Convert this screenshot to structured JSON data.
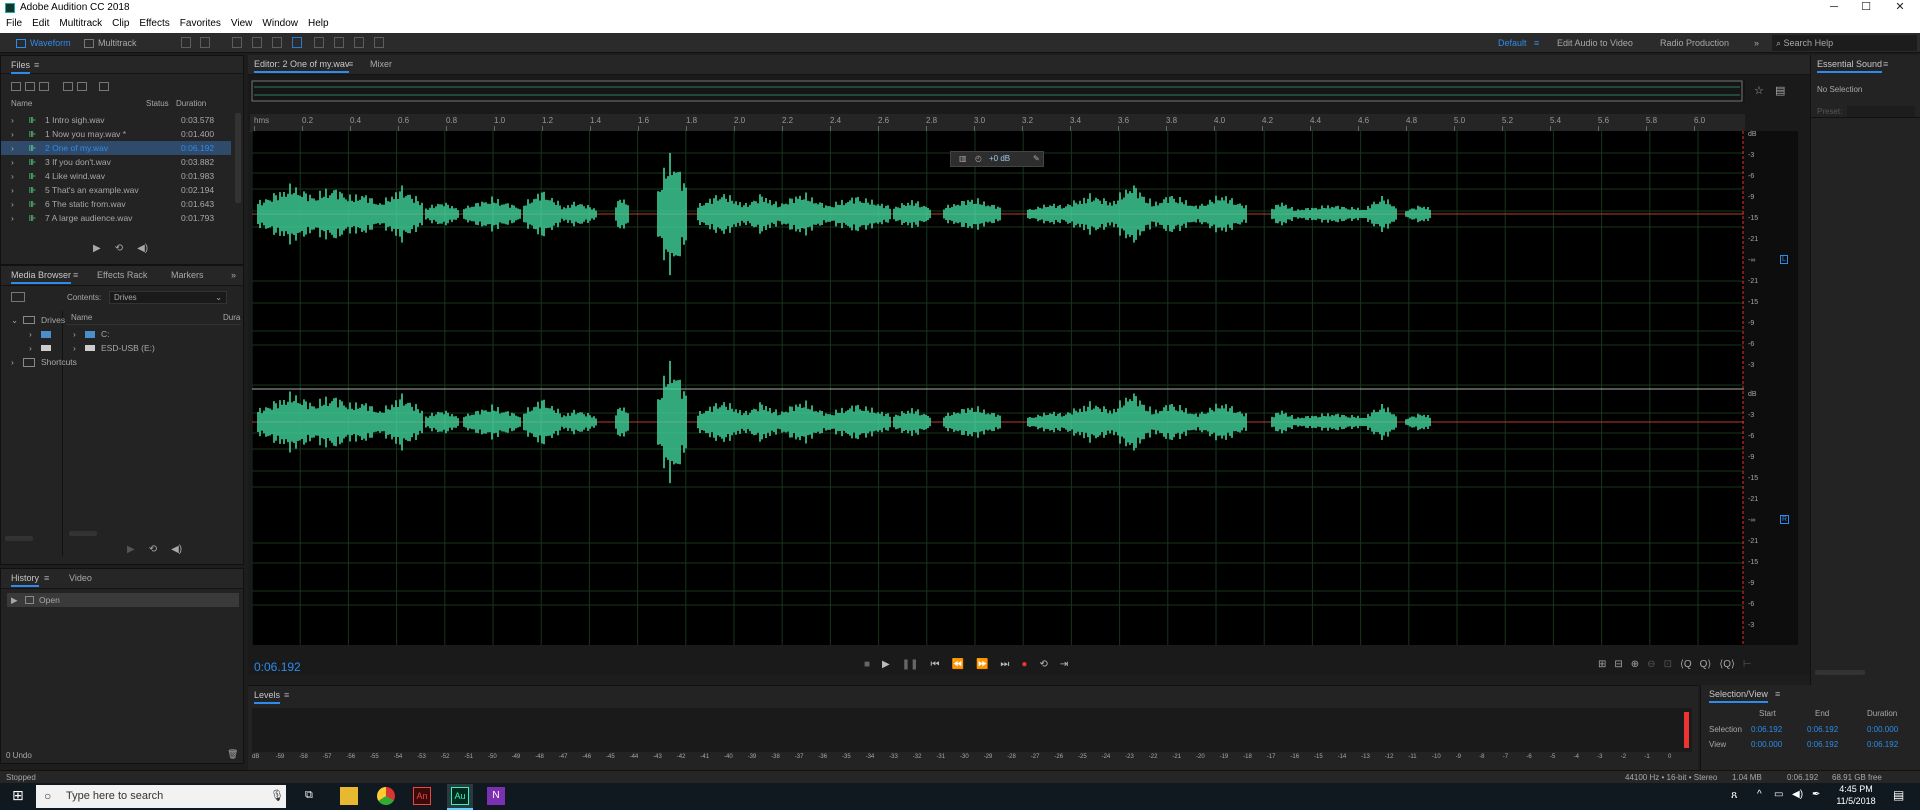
{
  "window": {
    "title": "Adobe Audition CC 2018",
    "minimize": "─",
    "maximize": "☐",
    "close": "✕"
  },
  "menu": [
    "File",
    "Edit",
    "Multitrack",
    "Clip",
    "Effects",
    "Favorites",
    "View",
    "Window",
    "Help"
  ],
  "toolbar": {
    "waveform": "Waveform",
    "multitrack": "Multitrack",
    "workspaces": [
      "Default",
      "Edit Audio to Video",
      "Radio Production"
    ],
    "more": "»",
    "search_placeholder": "Search Help"
  },
  "files": {
    "title": "Files",
    "cols": {
      "name": "Name",
      "status": "Status",
      "duration": "Duration"
    },
    "items": [
      {
        "name": "1 Intro sigh.wav",
        "duration": "0:03.578",
        "selected": false
      },
      {
        "name": "1 Now you may.wav *",
        "duration": "0:01.400",
        "selected": false
      },
      {
        "name": "2 One of my.wav",
        "duration": "0:06.192",
        "selected": true
      },
      {
        "name": "3 If you don't.wav",
        "duration": "0:03.882",
        "selected": false
      },
      {
        "name": "4 Like wind.wav",
        "duration": "0:01.983",
        "selected": false
      },
      {
        "name": "5 That's an example.wav",
        "duration": "0:02.194",
        "selected": false
      },
      {
        "name": "6 The static from.wav",
        "duration": "0:01.643",
        "selected": false
      },
      {
        "name": "7 A large audience.wav",
        "duration": "0:01.793",
        "selected": false
      }
    ]
  },
  "media": {
    "tabs": [
      "Media Browser",
      "Effects Rack",
      "Markers"
    ],
    "contents_label": "Contents:",
    "contents_value": "Drives",
    "tree": [
      "Drives",
      "Shortcuts"
    ],
    "cols": {
      "name": "Name",
      "duration": "Dura"
    },
    "drives": [
      "C:",
      "ESD-USB (E:)"
    ]
  },
  "history": {
    "tabs": [
      "History",
      "Video"
    ],
    "items": [
      "Open"
    ],
    "undo": "0 Undo"
  },
  "editor": {
    "tab": "Editor: 2 One of my.wav",
    "mixer": "Mixer",
    "time": "0:06.192",
    "gain": "+0 dB",
    "ruler": [
      "hms",
      "0.2",
      "0.4",
      "0.6",
      "0.8",
      "1.0",
      "1.2",
      "1.4",
      "1.6",
      "1.8",
      "2.0",
      "2.2",
      "2.4",
      "2.6",
      "2.8",
      "3.0",
      "3.2",
      "3.4",
      "3.6",
      "3.8",
      "4.0",
      "4.2",
      "4.4",
      "4.6",
      "4.8",
      "5.0",
      "5.2",
      "5.4",
      "5.6",
      "5.8",
      "6.0"
    ],
    "db_scale": [
      "dB",
      "-3",
      "-6",
      "-9",
      "-15",
      "-21",
      "-∞",
      "-21",
      "-15",
      "-9",
      "-6",
      "-3"
    ],
    "channels": [
      "L",
      "R"
    ]
  },
  "essential": {
    "title": "Essential Sound",
    "no_selection": "No Selection",
    "preset": "Preset:"
  },
  "levels": {
    "title": "Levels",
    "scale": [
      "dB",
      "-59",
      "-58",
      "-57",
      "-56",
      "-55",
      "-54",
      "-53",
      "-52",
      "-51",
      "-50",
      "-49",
      "-48",
      "-47",
      "-46",
      "-45",
      "-44",
      "-43",
      "-42",
      "-41",
      "-40",
      "-39",
      "-38",
      "-37",
      "-36",
      "-35",
      "-34",
      "-33",
      "-32",
      "-31",
      "-30",
      "-29",
      "-28",
      "-27",
      "-26",
      "-25",
      "-24",
      "-23",
      "-22",
      "-21",
      "-20",
      "-19",
      "-18",
      "-17",
      "-16",
      "-15",
      "-14",
      "-13",
      "-12",
      "-11",
      "-10",
      "-9",
      "-8",
      "-7",
      "-6",
      "-5",
      "-4",
      "-3",
      "-2",
      "-1",
      "0"
    ]
  },
  "selview": {
    "title": "Selection/View",
    "cols": [
      "Start",
      "End",
      "Duration"
    ],
    "rows": [
      {
        "label": "Selection",
        "start": "0:06.192",
        "end": "0:06.192",
        "duration": "0:00.000"
      },
      {
        "label": "View",
        "start": "0:00.000",
        "end": "0:06.192",
        "duration": "0:06.192"
      }
    ]
  },
  "status": {
    "left": "Stopped",
    "format": "44100 Hz • 16-bit • Stereo",
    "size": "1.04 MB",
    "dur": "0:06.192",
    "free": "68.91 GB free"
  },
  "taskbar": {
    "search": "Type here to search",
    "time": "4:45 PM",
    "date": "11/5/2018"
  }
}
